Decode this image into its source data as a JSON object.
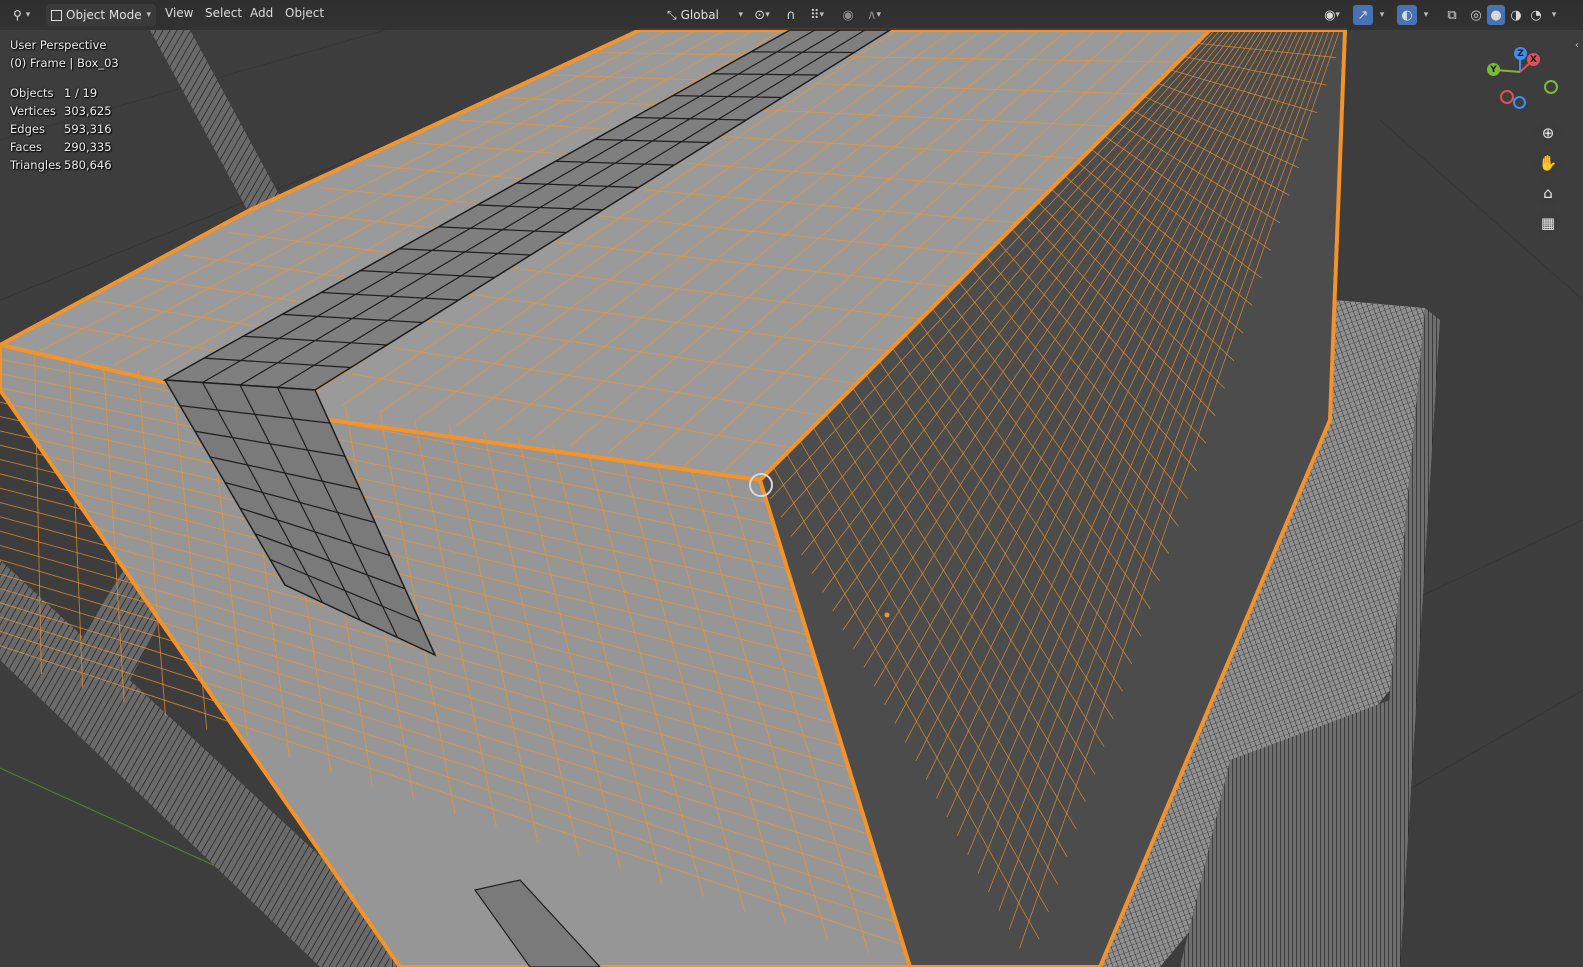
{
  "header": {
    "editor_type_icon": "3d-viewport-icon",
    "mode_label": "Object Mode",
    "menus": [
      "View",
      "Select",
      "Add",
      "Object"
    ],
    "transform_orientation": "Global"
  },
  "overlay": {
    "view_name": "User Perspective",
    "object_info": "(0) Frame | Box_03",
    "stats": [
      {
        "label": "Objects",
        "value": "1 / 19"
      },
      {
        "label": "Vertices",
        "value": "303,625"
      },
      {
        "label": "Edges",
        "value": "593,316"
      },
      {
        "label": "Faces",
        "value": "290,335"
      },
      {
        "label": "Triangles",
        "value": "580,646"
      }
    ]
  },
  "gizmo": {
    "x": "X",
    "y": "Y",
    "z": "Z"
  },
  "colors": {
    "selection": "#f3932a",
    "mesh_face": "#8f8f8f",
    "background": "#3d3d3d",
    "axis_x": "#e44d5c",
    "axis_y": "#7ab93a",
    "axis_z": "#3f8ff0"
  }
}
